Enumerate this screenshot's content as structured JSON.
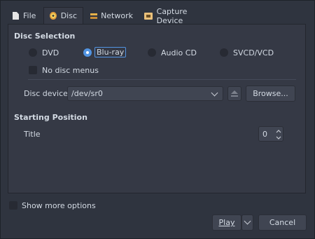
{
  "tabs": [
    {
      "icon": "file-icon",
      "label": "File"
    },
    {
      "icon": "disc-icon",
      "label": "Disc"
    },
    {
      "icon": "network-icon",
      "label": "Network"
    },
    {
      "icon": "capture-device-icon",
      "label": "Capture Device"
    }
  ],
  "disc_selection": {
    "title": "Disc Selection",
    "options": [
      "DVD",
      "Blu-ray",
      "Audio CD",
      "SVCD/VCD"
    ],
    "selected": "Blu-ray",
    "no_menus_label": "No disc menus",
    "no_menus_checked": false,
    "device_label": "Disc device",
    "device_value": "/dev/sr0",
    "browse_label": "Browse..."
  },
  "starting_position": {
    "title": "Starting Position",
    "title_label": "Title",
    "title_value": "0"
  },
  "footer": {
    "show_more_label": "Show more options",
    "play_label": "Play",
    "cancel_label": "Cancel"
  }
}
